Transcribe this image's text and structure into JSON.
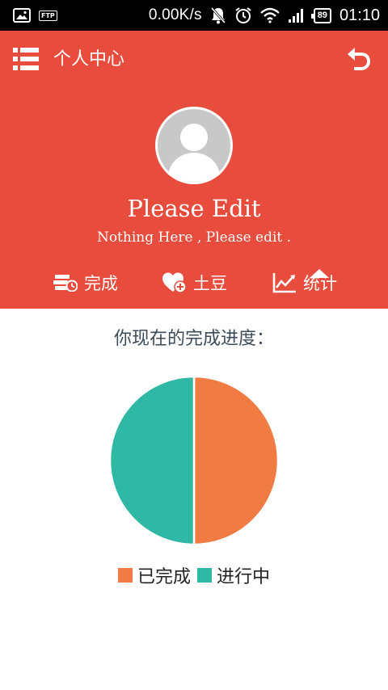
{
  "status_bar": {
    "ftp_label": "FTP",
    "net_speed": "0.00K/s",
    "battery_level": "89",
    "time": "01:10",
    "icons": [
      "image-icon",
      "ftp-icon",
      "mute-icon",
      "alarm-icon",
      "wifi-icon",
      "signal-icon",
      "battery-icon"
    ]
  },
  "header": {
    "title": "个人中心",
    "menu_icon": "list-menu-icon",
    "back_icon": "undo-icon",
    "bg_color": "#e74c3c"
  },
  "profile": {
    "name": "Please Edit",
    "description": "Nothing Here , Please edit ."
  },
  "tabs": [
    {
      "label": "完成",
      "icon": "coins-clock-icon"
    },
    {
      "label": "土豆",
      "icon": "heart-plus-icon"
    },
    {
      "label": "统计",
      "icon": "line-chart-icon",
      "active": true
    }
  ],
  "stats": {
    "heading": "你现在的完成进度："
  },
  "chart_data": {
    "type": "pie",
    "slices": [
      {
        "label": "已完成",
        "value": 50,
        "color": "#f07c43"
      },
      {
        "label": "进行中",
        "value": 50,
        "color": "#2fb9a5"
      }
    ],
    "legend_position": "bottom-center"
  }
}
